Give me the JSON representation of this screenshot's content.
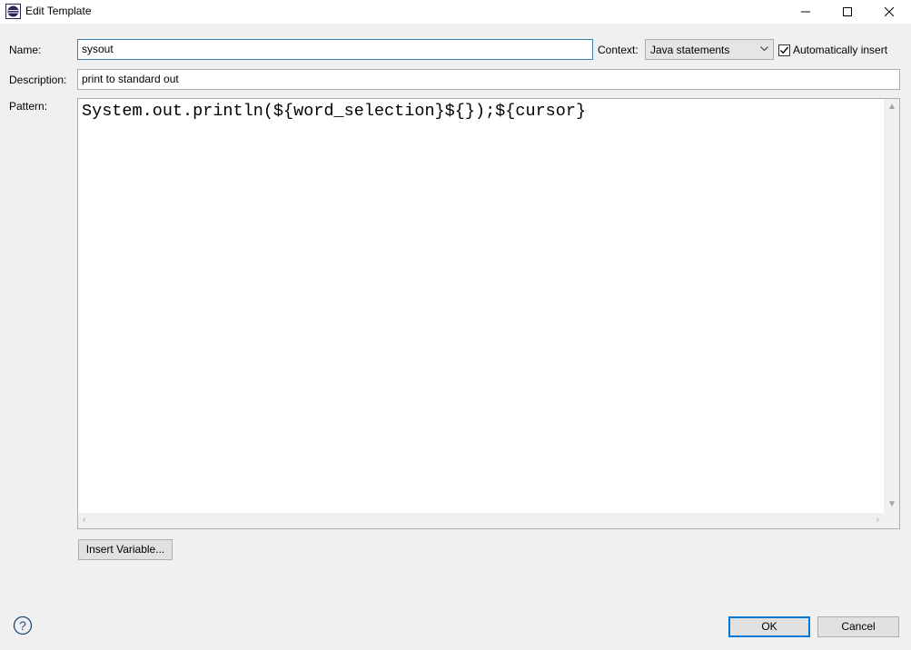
{
  "window": {
    "title": "Edit Template",
    "minimize_icon": "minimize-icon",
    "maximize_icon": "maximize-icon",
    "close_icon": "close-icon",
    "app_icon": "eclipse-icon"
  },
  "form": {
    "name_label": "Name:",
    "name_value": "sysout",
    "context_label": "Context:",
    "context_value": "Java statements",
    "auto_insert_label": "Automatically insert",
    "auto_insert_checked": true,
    "description_label": "Description:",
    "description_value": "print to standard out",
    "pattern_label": "Pattern:",
    "pattern_value": "System.out.println(${word_selection}${});${cursor}"
  },
  "buttons": {
    "insert_variable": "Insert Variable...",
    "ok": "OK",
    "cancel": "Cancel"
  },
  "colors": {
    "accent": "#0078d7",
    "focus_border": "#3c7fb1",
    "background": "#f0f0f0"
  }
}
